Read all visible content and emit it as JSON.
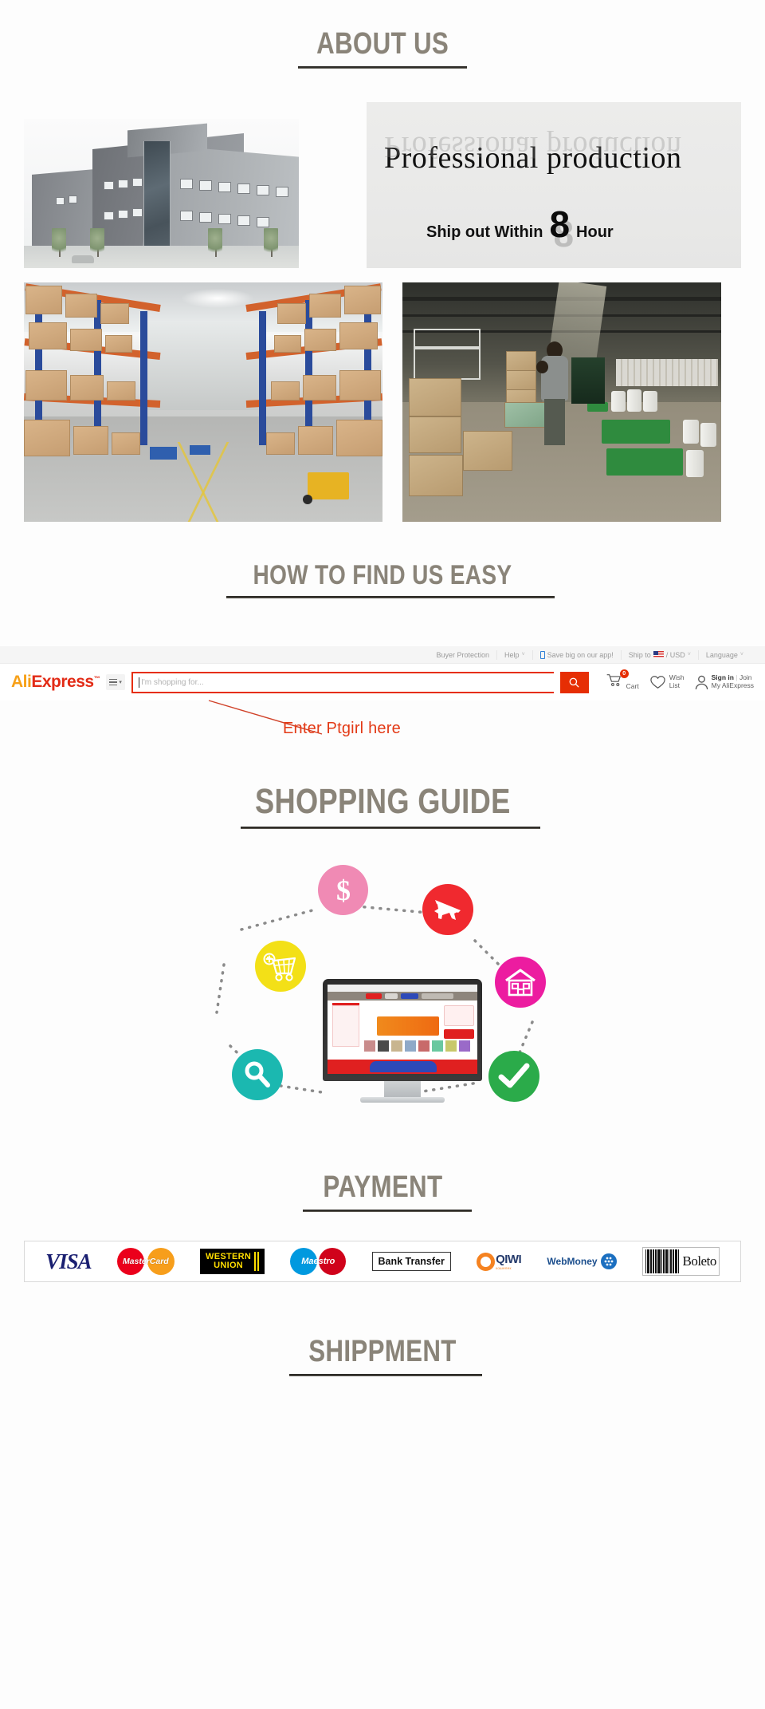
{
  "sections": {
    "about_us": {
      "heading": "ABOUT US"
    },
    "how_to_find": {
      "heading": "HOW TO FIND US EASY"
    },
    "shopping_guide": {
      "heading": "SHOPPING GUIDE"
    },
    "payment": {
      "heading": "PAYMENT"
    },
    "shippment": {
      "heading": "SHIPPMENT"
    }
  },
  "hero": {
    "banner_title": "Professional production",
    "ship_prefix": "Ship out Within",
    "ship_number": "8",
    "ship_suffix": "Hour",
    "building_photo_alt": "company-office-building",
    "warehouse_left_alt": "warehouse-aisle-racking",
    "warehouse_right_alt": "warehouse-worker-packing-boxes"
  },
  "aliexpress": {
    "topbar": [
      {
        "label": "Buyer Protection",
        "caret": "",
        "icon": ""
      },
      {
        "label": "Help",
        "caret": "˅",
        "icon": ""
      },
      {
        "label": "Save big on our app!",
        "caret": "",
        "icon": "phone-icon"
      },
      {
        "label": "Ship to",
        "caret": "˅",
        "icon": "us-flag-icon",
        "suffix": "/ USD"
      },
      {
        "label": "Language",
        "caret": "˅",
        "icon": ""
      }
    ],
    "logo": {
      "part1": "Ali",
      "part2": "Express",
      "tm": "™"
    },
    "category_menu": {
      "caret": "▾"
    },
    "search": {
      "placeholder": "I'm shopping for...",
      "value": "",
      "button_icon": "search-icon"
    },
    "cart": {
      "icon": "cart-icon",
      "count": "0",
      "label": "Cart"
    },
    "wishlist": {
      "icon": "heart-icon",
      "line1": "Wish",
      "line2": "List"
    },
    "account": {
      "icon": "user-icon",
      "sign_in": "Sign in",
      "divider": "|",
      "join": "Join",
      "my_account": "My AliExpress"
    },
    "annotation": {
      "text": "Enter Ptgirl here",
      "color": "#e33a16"
    }
  },
  "guide_diagram": {
    "nodes": [
      {
        "name": "dollar-node",
        "icon": "dollar-icon",
        "color": "#f08ab4",
        "symbol": "$"
      },
      {
        "name": "airplane-node",
        "icon": "airplane-icon",
        "color": "#f0292f",
        "symbol": "✈"
      },
      {
        "name": "house-node",
        "icon": "house-icon",
        "color": "#ec1ca0",
        "symbol": "⌂"
      },
      {
        "name": "check-node",
        "icon": "check-icon",
        "color": "#2bab4a",
        "symbol": "✔"
      },
      {
        "name": "search-node",
        "icon": "magnifier-icon",
        "color": "#1bb8b0",
        "symbol": "⚲"
      },
      {
        "name": "cart-node",
        "icon": "add-cart-icon",
        "color": "#f3e017",
        "symbol": "Ὥ2"
      }
    ],
    "center": {
      "name": "desktop-monitor",
      "icon": "monitor-icon"
    }
  },
  "payment_methods": [
    {
      "name": "visa",
      "label": "VISA"
    },
    {
      "name": "mastercard",
      "label": "MasterCard"
    },
    {
      "name": "western-union",
      "label_line1": "WESTERN",
      "label_line2": "UNION"
    },
    {
      "name": "maestro",
      "label": "Maestro"
    },
    {
      "name": "bank-transfer",
      "label": "Bank Transfer"
    },
    {
      "name": "qiwi",
      "label": "QIWI",
      "sub": "кошелек"
    },
    {
      "name": "webmoney",
      "label": "WebMoney"
    },
    {
      "name": "boleto",
      "label": "Boleto"
    }
  ],
  "colors": {
    "heading": "#8a8479",
    "rule": "#2e2c28",
    "ali_orange": "#f7a018",
    "ali_red": "#e22b16",
    "accent_red": "#e62e04"
  }
}
